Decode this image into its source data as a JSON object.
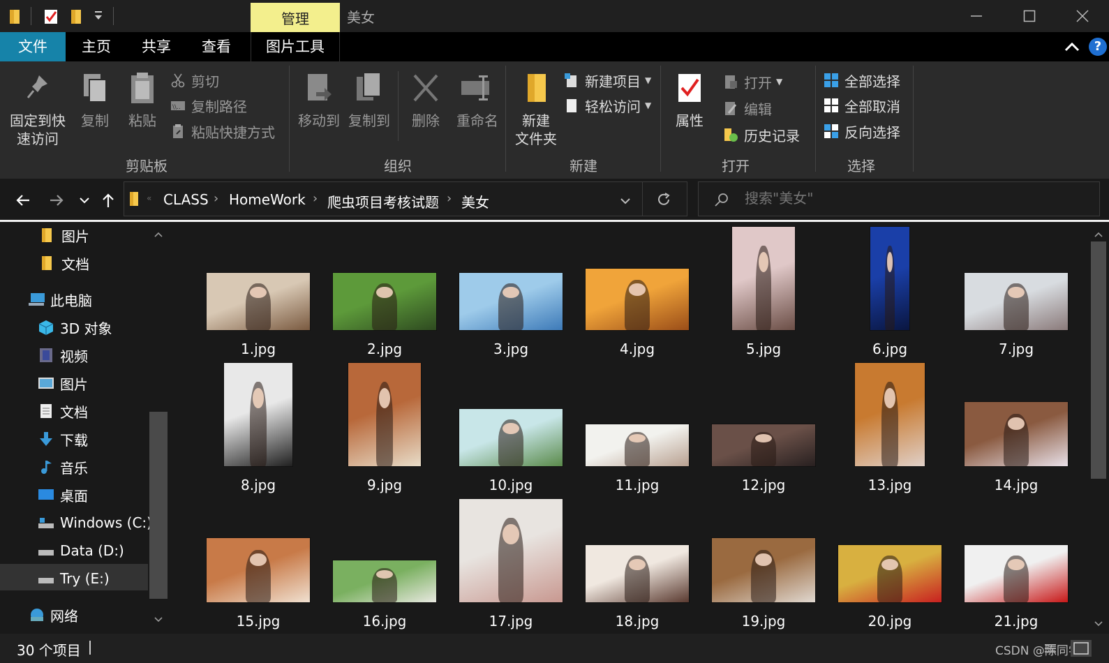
{
  "titlebar": {
    "manage_tab": "管理",
    "window_title": "美女"
  },
  "tabs": {
    "file": "文件",
    "home": "主页",
    "share": "共享",
    "view": "查看",
    "picture_tools": "图片工具"
  },
  "ribbon": {
    "clipboard": {
      "label": "剪贴板",
      "pin_quick_access_line1": "固定到快",
      "pin_quick_access_line2": "速访问",
      "copy": "复制",
      "paste": "粘贴",
      "cut": "剪切",
      "copy_path": "复制路径",
      "paste_shortcut": "粘贴快捷方式"
    },
    "organize": {
      "label": "组织",
      "move_to": "移动到",
      "copy_to": "复制到",
      "delete": "删除",
      "rename": "重命名"
    },
    "new": {
      "label": "新建",
      "new_folder_line1": "新建",
      "new_folder_line2": "文件夹",
      "new_item": "新建项目",
      "easy_access": "轻松访问"
    },
    "open": {
      "label": "打开",
      "properties": "属性",
      "open": "打开",
      "edit": "编辑",
      "history": "历史记录"
    },
    "select": {
      "label": "选择",
      "select_all": "全部选择",
      "select_none": "全部取消",
      "invert_selection": "反向选择"
    }
  },
  "address": {
    "breadcrumbs": [
      "CLASS",
      "HomeWork",
      "爬虫项目考核试题",
      "美女"
    ],
    "search_placeholder": "搜索\"美女\""
  },
  "nav_pane": {
    "items": [
      {
        "label": "图片"
      },
      {
        "label": "文档"
      },
      {
        "label": "此电脑"
      },
      {
        "label": "3D 对象"
      },
      {
        "label": "视频"
      },
      {
        "label": "图片"
      },
      {
        "label": "文档"
      },
      {
        "label": "下载"
      },
      {
        "label": "音乐"
      },
      {
        "label": "桌面"
      },
      {
        "label": "Windows (C:)"
      },
      {
        "label": "Data (D:)"
      },
      {
        "label": "Try (E:)"
      },
      {
        "label": "网络"
      }
    ]
  },
  "files": [
    {
      "name": "1.jpg",
      "colors": [
        "#d8c8b4",
        "#7a5a40"
      ]
    },
    {
      "name": "2.jpg",
      "colors": [
        "#5d9a3a",
        "#2e4a20"
      ]
    },
    {
      "name": "3.jpg",
      "colors": [
        "#9ecbea",
        "#3d7ab8"
      ]
    },
    {
      "name": "4.jpg",
      "colors": [
        "#f0a43a",
        "#9a4d18"
      ]
    },
    {
      "name": "5.jpg",
      "colors": [
        "#e0c8c8",
        "#6b4e46"
      ]
    },
    {
      "name": "6.jpg",
      "colors": [
        "#1a3fa8",
        "#0a1640"
      ]
    },
    {
      "name": "7.jpg",
      "colors": [
        "#d8dce0",
        "#8a7a7a"
      ]
    },
    {
      "name": "8.jpg",
      "colors": [
        "#e8e8e8",
        "#202020"
      ]
    },
    {
      "name": "9.jpg",
      "colors": [
        "#b8683a",
        "#e8dcc8"
      ]
    },
    {
      "name": "10.jpg",
      "colors": [
        "#c8e6e8",
        "#5a8a4a"
      ]
    },
    {
      "name": "11.jpg",
      "colors": [
        "#f2f2ee",
        "#b8a090"
      ]
    },
    {
      "name": "12.jpg",
      "colors": [
        "#6a5048",
        "#282020"
      ]
    },
    {
      "name": "13.jpg",
      "colors": [
        "#c87a30",
        "#e0d0c8"
      ]
    },
    {
      "name": "14.jpg",
      "colors": [
        "#8a5a40",
        "#e8e0e8"
      ]
    },
    {
      "name": "15.jpg",
      "colors": [
        "#c87a48",
        "#f0e0d0"
      ]
    },
    {
      "name": "16.jpg",
      "colors": [
        "#7ab060",
        "#e8e8e0"
      ]
    },
    {
      "name": "17.jpg",
      "colors": [
        "#e8e4e0",
        "#c89890"
      ]
    },
    {
      "name": "18.jpg",
      "colors": [
        "#f0e8e0",
        "#5a3a30"
      ]
    },
    {
      "name": "19.jpg",
      "colors": [
        "#9a6a40",
        "#e0d8d0"
      ]
    },
    {
      "name": "20.jpg",
      "colors": [
        "#d8b040",
        "#c82020"
      ]
    },
    {
      "name": "21.jpg",
      "colors": [
        "#f0f0f0",
        "#c81818"
      ]
    }
  ],
  "status": {
    "item_count": "30 个项目",
    "watermark": "CSDN @陈同学ci"
  },
  "colors": {
    "file_tab_accent": "#1683a9",
    "manage_tab_bg": "#f3ef8d",
    "folder_yellow": "#f6c84c"
  }
}
